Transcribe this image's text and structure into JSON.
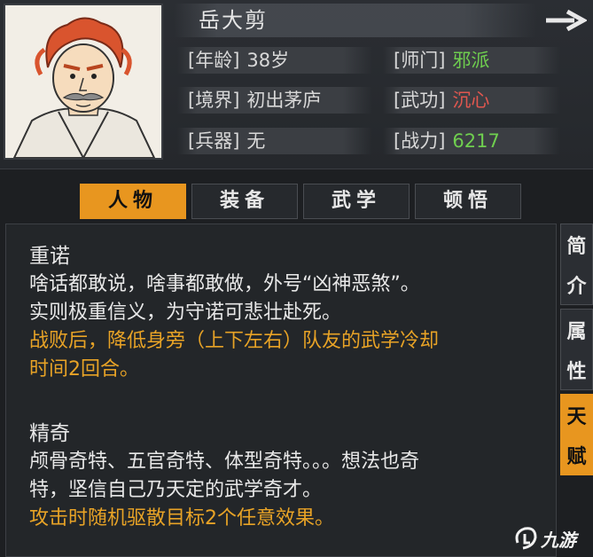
{
  "character": {
    "name": "岳大剪",
    "stats": [
      {
        "label": "[年龄]",
        "value": "38岁",
        "color": "#d8d8d8"
      },
      {
        "label": "[师门]",
        "value": "邪派",
        "color": "#6fcf4f"
      },
      {
        "label": "[境界]",
        "value": "初出茅庐",
        "color": "#d8d8d8"
      },
      {
        "label": "[武功]",
        "value": "沉心",
        "color": "#e0574f"
      },
      {
        "label": "[兵器]",
        "value": "无",
        "color": "#d8d8d8"
      },
      {
        "label": "[战力]",
        "value": "6217",
        "color": "#6fcf4f"
      }
    ]
  },
  "tabs": [
    {
      "label": "人物",
      "active": true
    },
    {
      "label": "装备",
      "active": false
    },
    {
      "label": "武学",
      "active": false
    },
    {
      "label": "顿悟",
      "active": false
    }
  ],
  "side_tabs": [
    {
      "label": "简介",
      "chars": [
        "简",
        "介"
      ],
      "active": false
    },
    {
      "label": "属性",
      "chars": [
        "属",
        "性"
      ],
      "active": false
    },
    {
      "label": "天赋",
      "chars": [
        "天",
        "赋"
      ],
      "active": true
    }
  ],
  "talents": [
    {
      "title": "重诺",
      "desc_lines": [
        "啥话都敢说，啥事都敢做，外号“凶神恶煞”。",
        "实则极重信义，为守诺可悲壮赴死。"
      ],
      "effect_lines": [
        "战败后，降低身旁（上下左右）队友的武学冷却",
        "时间2回合。"
      ]
    },
    {
      "title": "精奇",
      "desc_lines": [
        "颅骨奇特、五官奇特、体型奇特。。。想法也奇",
        "特，坚信自己乃天定的武学奇才。"
      ],
      "effect_lines": [
        "攻击时随机驱散目标2个任意效果。"
      ]
    }
  ],
  "watermark": {
    "text": "九游"
  },
  "colors": {
    "accent": "#e8961f",
    "effect": "#e8a326",
    "green": "#6fcf4f",
    "red": "#e0574f"
  },
  "icons": {
    "next": "arrow-right-icon",
    "watermark_logo": "nine-game-logo-icon"
  }
}
